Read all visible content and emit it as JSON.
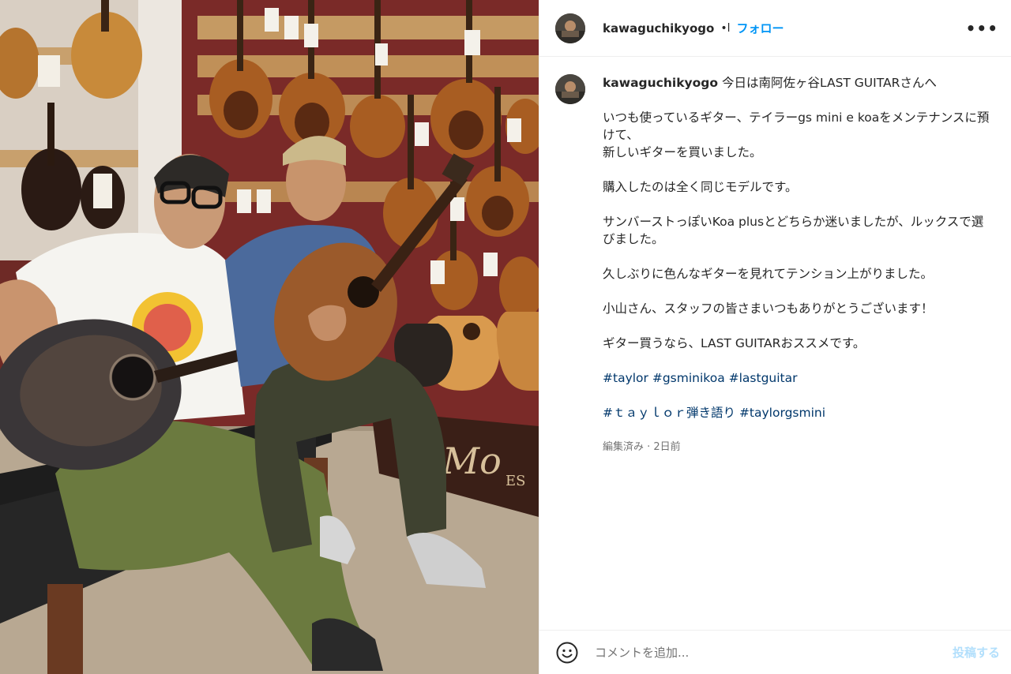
{
  "post": {
    "username": "kawaguchikyogo",
    "separator": "•l",
    "follow_label": "フォロー",
    "more_label": "•••",
    "caption": {
      "first_line": "今日は南阿佐ヶ谷LAST GUITARさんへ",
      "paragraphs": [
        "いつも使っているギター、テイラーgs mini e koaをメンテナンスに預けて、\n新しいギターを買いました。",
        "購入したのは全く同じモデルです。",
        "サンバーストっぽいKoa plusとどちらか迷いましたが、ルックスで選びました。",
        "久しぶりに色んなギターを見れてテンション上がりました。",
        "小山さん、スタッフの皆さまいつもありがとうございます！",
        "ギター買うなら、LAST GUITARおススメです。"
      ],
      "hashtags_line1": [
        "#taylor",
        "#gsminikoa",
        "#lastguitar"
      ],
      "hashtags_line2": [
        "#ｔａｙｌｏｒ弾き語り",
        "#taylorgsmini"
      ]
    },
    "edited_meta": "編集済み · 2日前",
    "comment_placeholder": "コメントを追加...",
    "post_button": "投稿する",
    "photo_sign_text": "Mo",
    "photo_sign_sub": "ES"
  }
}
